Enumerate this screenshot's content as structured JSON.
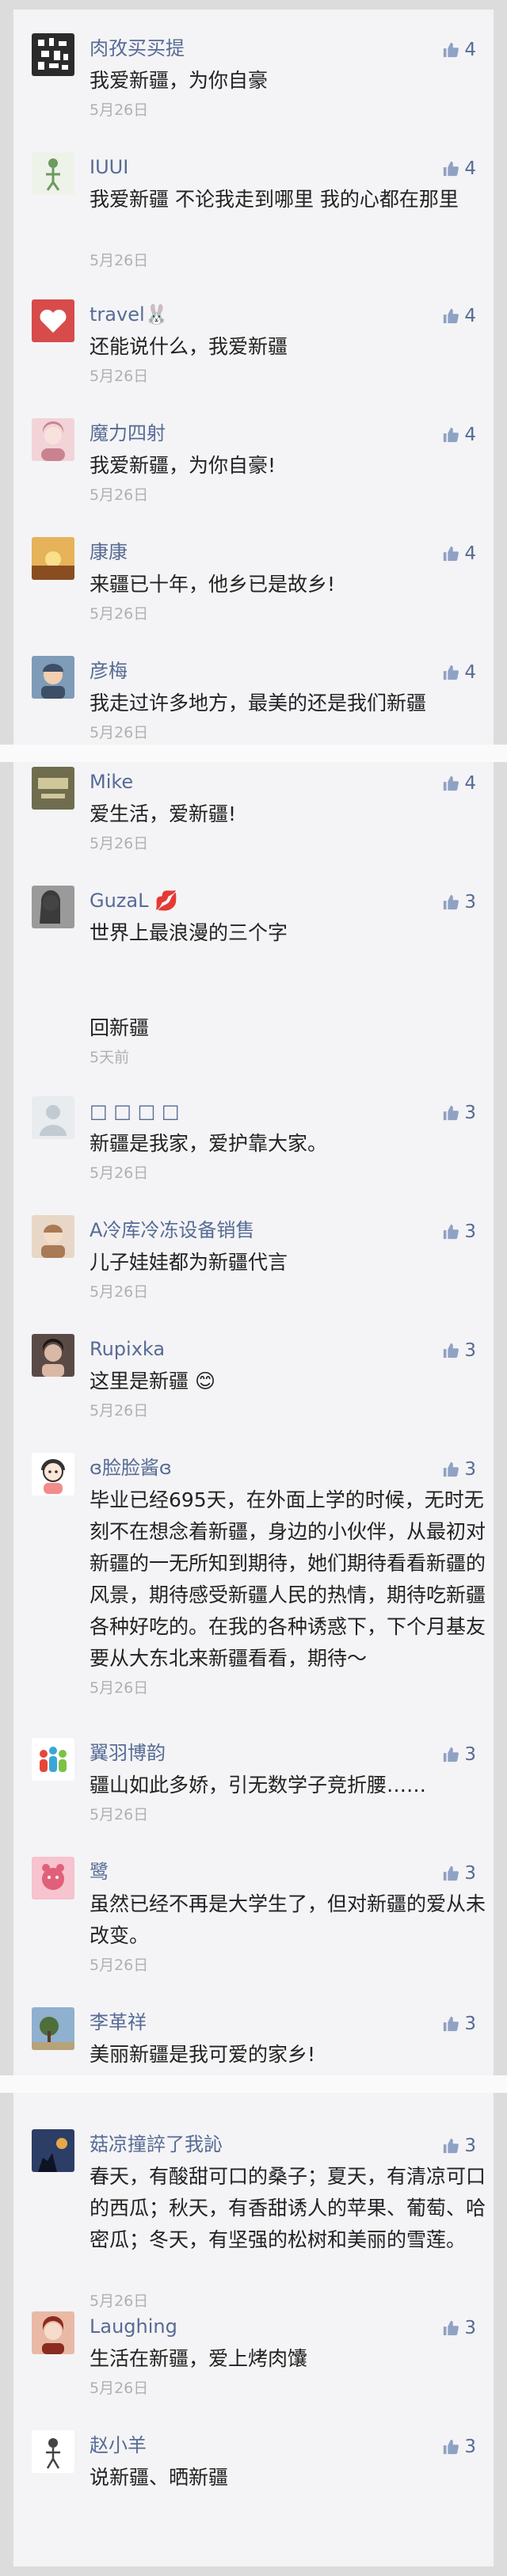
{
  "sections": [
    {
      "comments": [
        {
          "nickname": "肉孜买买提",
          "text": "我爱新疆，为你自豪",
          "date": "5月26日",
          "likes": "4"
        },
        {
          "nickname": "IUUI",
          "text": "我爱新疆  不论我走到哪里  我的心都在那里",
          "date": "5月26日",
          "likes": "4"
        },
        {
          "nickname": "travel🐰",
          "text": "还能说什么，我爱新疆",
          "date": "5月26日",
          "likes": "4"
        },
        {
          "nickname": "魔力四射",
          "text": "我爱新疆，为你自豪!",
          "date": "5月26日",
          "likes": "4"
        },
        {
          "nickname": "康康",
          "text": "来疆已十年，他乡已是故乡!",
          "date": "5月26日",
          "likes": "4"
        },
        {
          "nickname": "彦梅",
          "text": "我走过许多地方，最美的还是我们新疆",
          "date": "5月26日",
          "likes": "4"
        }
      ]
    },
    {
      "comments": [
        {
          "nickname": "Mike",
          "text": "爱生活，爱新疆!",
          "date": "5月26日",
          "likes": "4"
        },
        {
          "nickname": "GuzaL 💋",
          "text": "世界上最浪漫的三个字\n\n\n回新疆",
          "date": "5天前",
          "likes": "3"
        },
        {
          "nickname": "□ □ □ □",
          "text": "新疆是我家，爱护靠大家。",
          "date": "5月26日",
          "likes": "3"
        },
        {
          "nickname": "A冷库冷冻设备销售",
          "text": "儿子娃娃都为新疆代言",
          "date": "5月26日",
          "likes": "3"
        },
        {
          "nickname": "Rupixka",
          "text": "这里是新疆 😊",
          "date": "5月26日",
          "likes": "3"
        },
        {
          "nickname": "ɞ脸脸酱ɞ",
          "text": "毕业已经695天，在外面上学的时候，无时无刻不在想念着新疆，身边的小伙伴，从最初对新疆的一无所知到期待，她们期待看看新疆的风景，期待感受新疆人民的热情，期待吃新疆各种好吃的。在我的各种诱惑下，下个月基友要从大东北来新疆看看，期待～",
          "date": "5月26日",
          "likes": "3"
        },
        {
          "nickname": "翼羽博韵",
          "text": "疆山如此多娇，引无数学子竞折腰……",
          "date": "5月26日",
          "likes": "3"
        },
        {
          "nickname": "鹭",
          "text": "虽然已经不再是大学生了，但对新疆的爱从未改变。",
          "date": "5月26日",
          "likes": "3"
        },
        {
          "nickname": "李革祥",
          "text": "美丽新疆是我可爱的家乡!",
          "date": "5月26日",
          "likes": "3"
        }
      ]
    },
    {
      "comments": [
        {
          "nickname": "菇凉撞誶了我訫",
          "text": "春天，有酸甜可口的桑子；夏天，有清凉可口的西瓜；秋天，有香甜诱人的苹果、葡萄、哈密瓜；冬天，有坚强的松树和美丽的雪莲。",
          "date": "5月26日",
          "likes": "3"
        },
        {
          "nickname": "Laughing",
          "text": "生活在新疆，爱上烤肉馕",
          "date": "5月26日",
          "likes": "3"
        },
        {
          "nickname": "赵小羊",
          "text": "说新疆、晒新疆",
          "date": "",
          "likes": "3"
        }
      ]
    }
  ],
  "avatars": [
    {
      "icon": "qr-pattern-icon",
      "bg": "#2b2b2b",
      "fg": "#ffffff"
    },
    {
      "icon": "figure-icon",
      "bg": "#eef3ea",
      "fg": "#6c9a5f"
    },
    {
      "icon": "heart-card-icon",
      "bg": "#d84b4b",
      "fg": "#ffffff"
    },
    {
      "icon": "girl-photo-icon",
      "bg": "#f2d3d8",
      "fg": "#c98390"
    },
    {
      "icon": "sunset-photo-icon",
      "bg": "#e6b25a",
      "fg": "#8a4d20"
    },
    {
      "icon": "child-photo-icon",
      "bg": "#7e9bb8",
      "fg": "#3c4f66"
    },
    {
      "icon": "banner-photo-icon",
      "bg": "#6f6d4e",
      "fg": "#cfc79a"
    },
    {
      "icon": "woman-bw-icon",
      "bg": "#9a9a9a",
      "fg": "#2a2a2a"
    },
    {
      "icon": "default-user-icon",
      "bg": "#e8ecef",
      "fg": "#c3cbd2"
    },
    {
      "icon": "baby-photo-icon",
      "bg": "#e8d7c6",
      "fg": "#a97a55"
    },
    {
      "icon": "woman-photo-icon",
      "bg": "#5a4a46",
      "fg": "#d9b9a6"
    },
    {
      "icon": "cartoon-girl-icon",
      "bg": "#ffffff",
      "fg": "#333333"
    },
    {
      "icon": "logo-people-icon",
      "bg": "#ffffff",
      "fg": "#3aa7d8"
    },
    {
      "icon": "pink-toy-icon",
      "bg": "#f6c3cf",
      "fg": "#e0607a"
    },
    {
      "icon": "tree-photo-icon",
      "bg": "#8fb0cf",
      "fg": "#4e6e3a"
    },
    {
      "icon": "silhouette-photo-icon",
      "bg": "#2c3e66",
      "fg": "#e8a84a"
    },
    {
      "icon": "red-hair-girl-icon",
      "bg": "#e9b9a6",
      "fg": "#8b2b20"
    },
    {
      "icon": "sketch-figure-icon",
      "bg": "#ffffff",
      "fg": "#444444"
    }
  ],
  "colors": {
    "nickname": "#576b95",
    "text": "#222222",
    "date": "#b0b0b0",
    "card": "#f4f4f6",
    "page": "#dcdcdc"
  }
}
